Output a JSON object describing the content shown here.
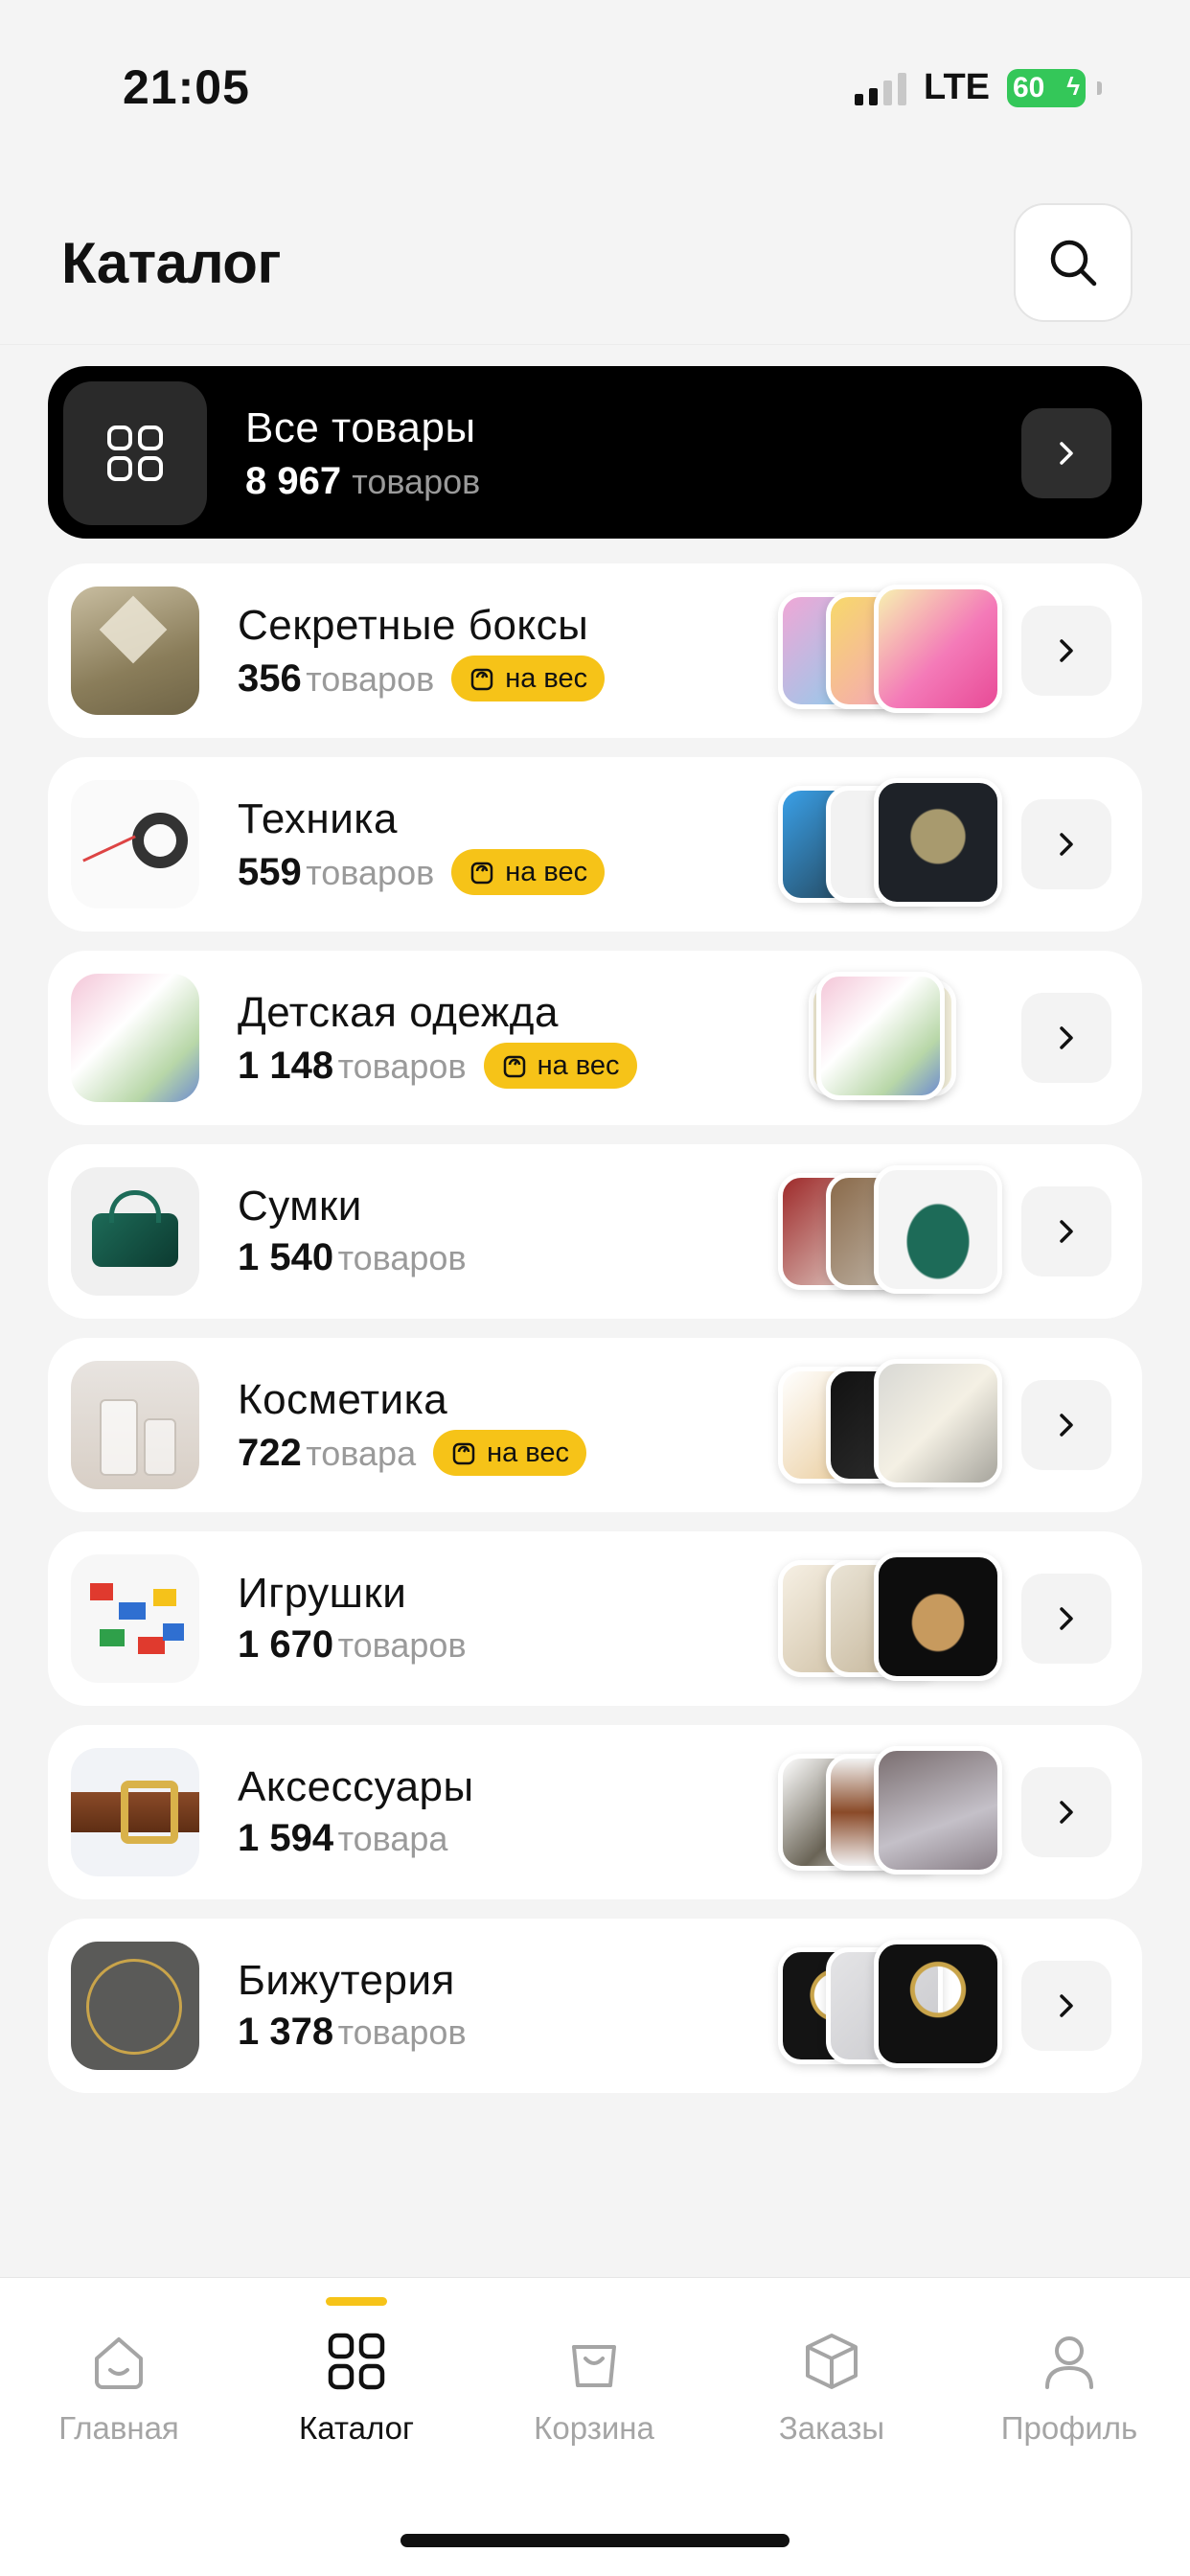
{
  "status_bar": {
    "time": "21:05",
    "network": "LTE",
    "battery": "60"
  },
  "header": {
    "title": "Каталог"
  },
  "all_goods": {
    "title": "Все товары",
    "count": "8 967",
    "unit": "товаров"
  },
  "categories": [
    {
      "name": "Секретные боксы",
      "count": "356",
      "unit": "товаров",
      "badge": "на вес"
    },
    {
      "name": "Техника",
      "count": "559",
      "unit": "товаров",
      "badge": "на вес"
    },
    {
      "name": "Детская одежда",
      "count": "1 148",
      "unit": "товаров",
      "badge": "на вес"
    },
    {
      "name": "Сумки",
      "count": "1 540",
      "unit": "товаров"
    },
    {
      "name": "Косметика",
      "count": "722",
      "unit": "товара",
      "badge": "на вес"
    },
    {
      "name": "Игрушки",
      "count": "1 670",
      "unit": "товаров"
    },
    {
      "name": "Аксессуары",
      "count": "1 594",
      "unit": "товара"
    },
    {
      "name": "Бижутерия",
      "count": "1 378",
      "unit": "товаров"
    }
  ],
  "bottom_nav": {
    "items": [
      {
        "label": "Главная",
        "icon": "home-icon"
      },
      {
        "label": "Каталог",
        "icon": "grid-icon",
        "active": true
      },
      {
        "label": "Корзина",
        "icon": "bag-icon"
      },
      {
        "label": "Заказы",
        "icon": "box-icon"
      },
      {
        "label": "Профиль",
        "icon": "profile-icon"
      }
    ]
  },
  "colors": {
    "accent": "#f6c318",
    "dark_card": "#000000",
    "background": "#f4f4f4"
  }
}
